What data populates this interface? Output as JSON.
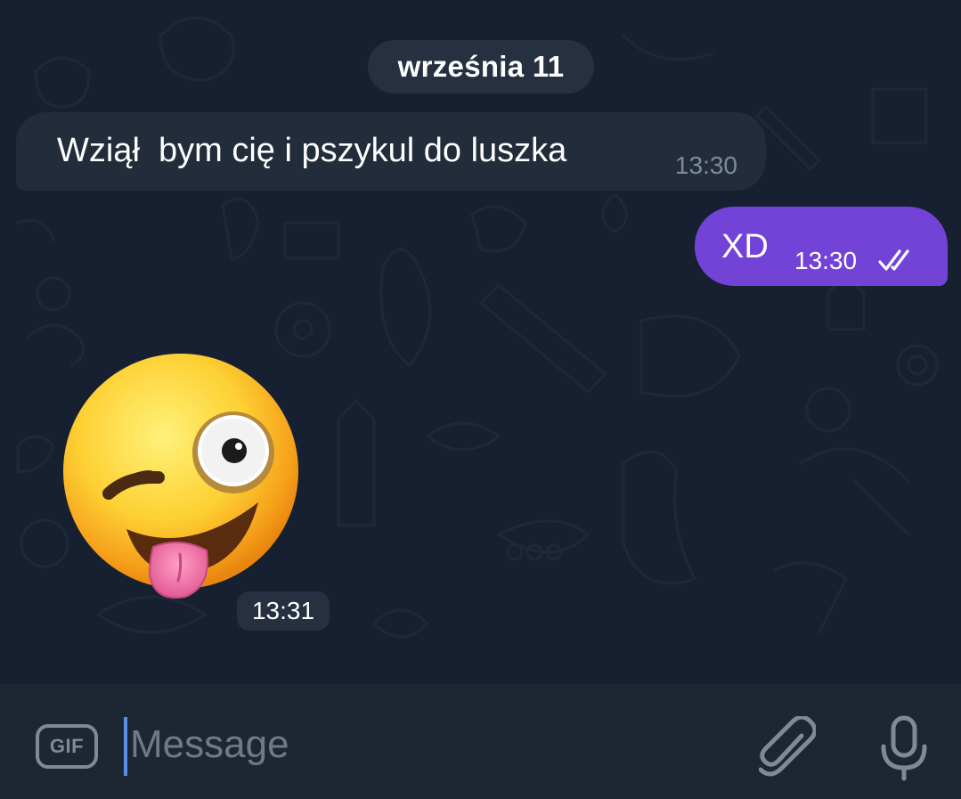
{
  "chat": {
    "date_separator": "września 11",
    "messages": [
      {
        "direction": "incoming",
        "text": "Wziął  bym cię i pszykul do luszka",
        "time": "13:30"
      },
      {
        "direction": "outgoing",
        "text": "XD",
        "time": "13:30",
        "status": "read"
      },
      {
        "direction": "incoming",
        "type": "sticker",
        "sticker": "winking-face-with-tongue-emoji",
        "time": "13:31"
      }
    ]
  },
  "composer": {
    "gif_label": "GIF",
    "placeholder": "Message",
    "value": ""
  },
  "icons": {
    "gif": "gif-icon",
    "attach": "paperclip-icon",
    "mic": "microphone-icon",
    "read_status": "double-check-icon"
  },
  "colors": {
    "background": "#172030",
    "incoming_bubble": "#222c3a",
    "outgoing_bubble": "#7243d6",
    "composer": "#1d2733",
    "cursor": "#5b8fe6",
    "icon": "#7f8a97"
  }
}
